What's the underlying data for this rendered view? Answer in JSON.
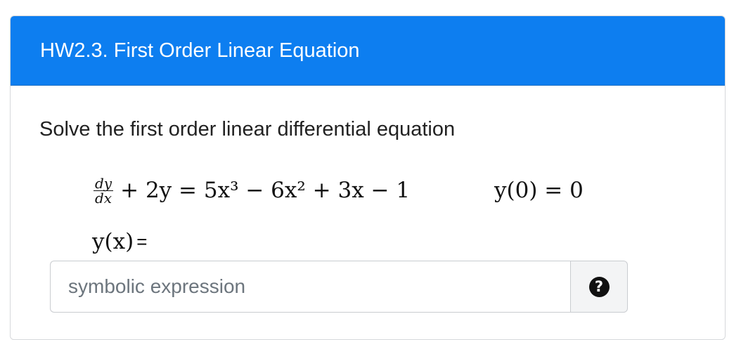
{
  "card": {
    "title": "HW2.3. First Order Linear Equation"
  },
  "question": {
    "prompt": "Solve the first order linear differential equation",
    "fraction_numerator": "dy",
    "fraction_denominator": "dx",
    "equation_rest": "+ 2y = 5x³ − 6x² + 3x − 1",
    "initial_condition": "y(0) = 0",
    "answer_label": "y(x)",
    "answer_equals": "="
  },
  "answer": {
    "placeholder": "symbolic expression",
    "value": "",
    "help_icon_glyph": "?"
  },
  "colors": {
    "header_bg": "#0d7ef0",
    "header_text": "#ffffff",
    "help_icon_bg": "#111111"
  }
}
